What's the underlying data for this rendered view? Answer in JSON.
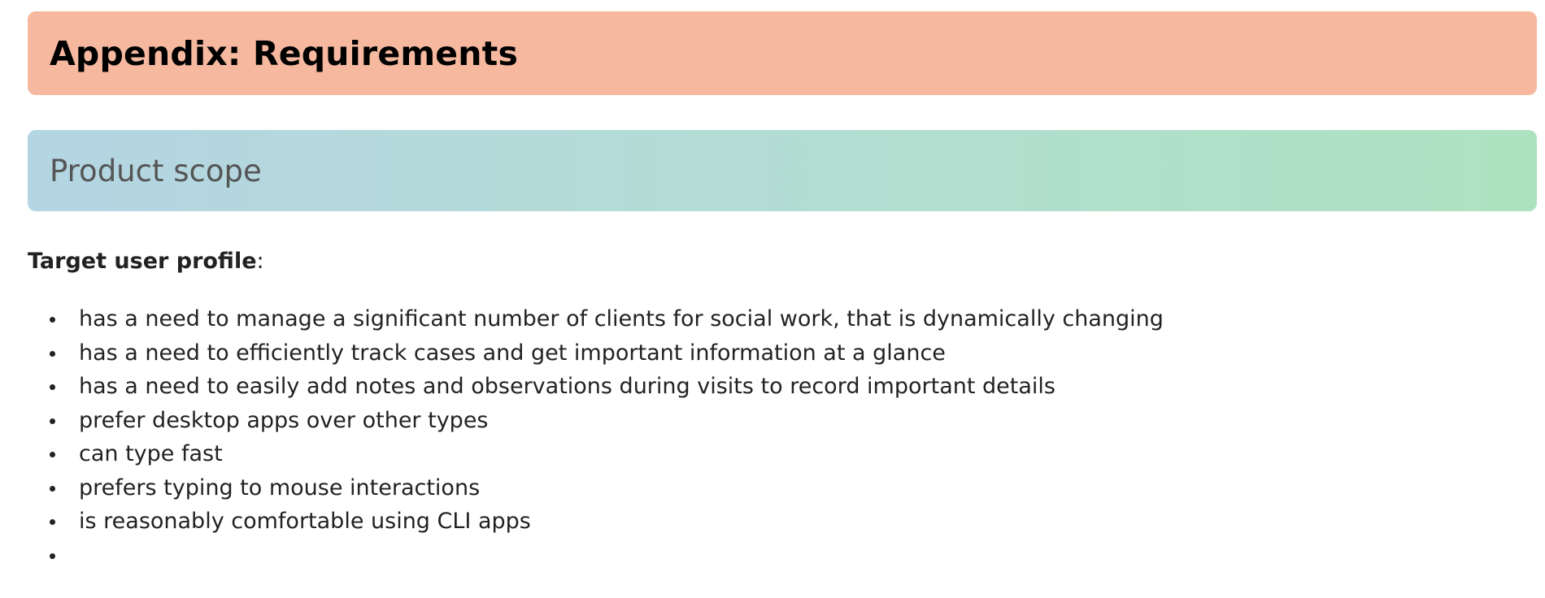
{
  "appendix": {
    "title": "Appendix: Requirements"
  },
  "section": {
    "title": "Product scope"
  },
  "profile": {
    "label": "Target user profile",
    "suffix": ":"
  },
  "items": [
    "has a need to manage a significant number of clients for social work, that is dynamically changing",
    "has a need to efficiently track cases and get important information at a glance",
    "has a need to easily add notes and observations during visits to record important details",
    "prefer desktop apps over other types",
    "can type fast",
    "prefers typing to mouse interactions",
    "is reasonably comfortable using CLI apps",
    ""
  ],
  "colors": {
    "appendix_banner": "#f6b9a0",
    "section_banner_start": "#b4d5e3",
    "section_banner_end": "#ade2c0"
  }
}
